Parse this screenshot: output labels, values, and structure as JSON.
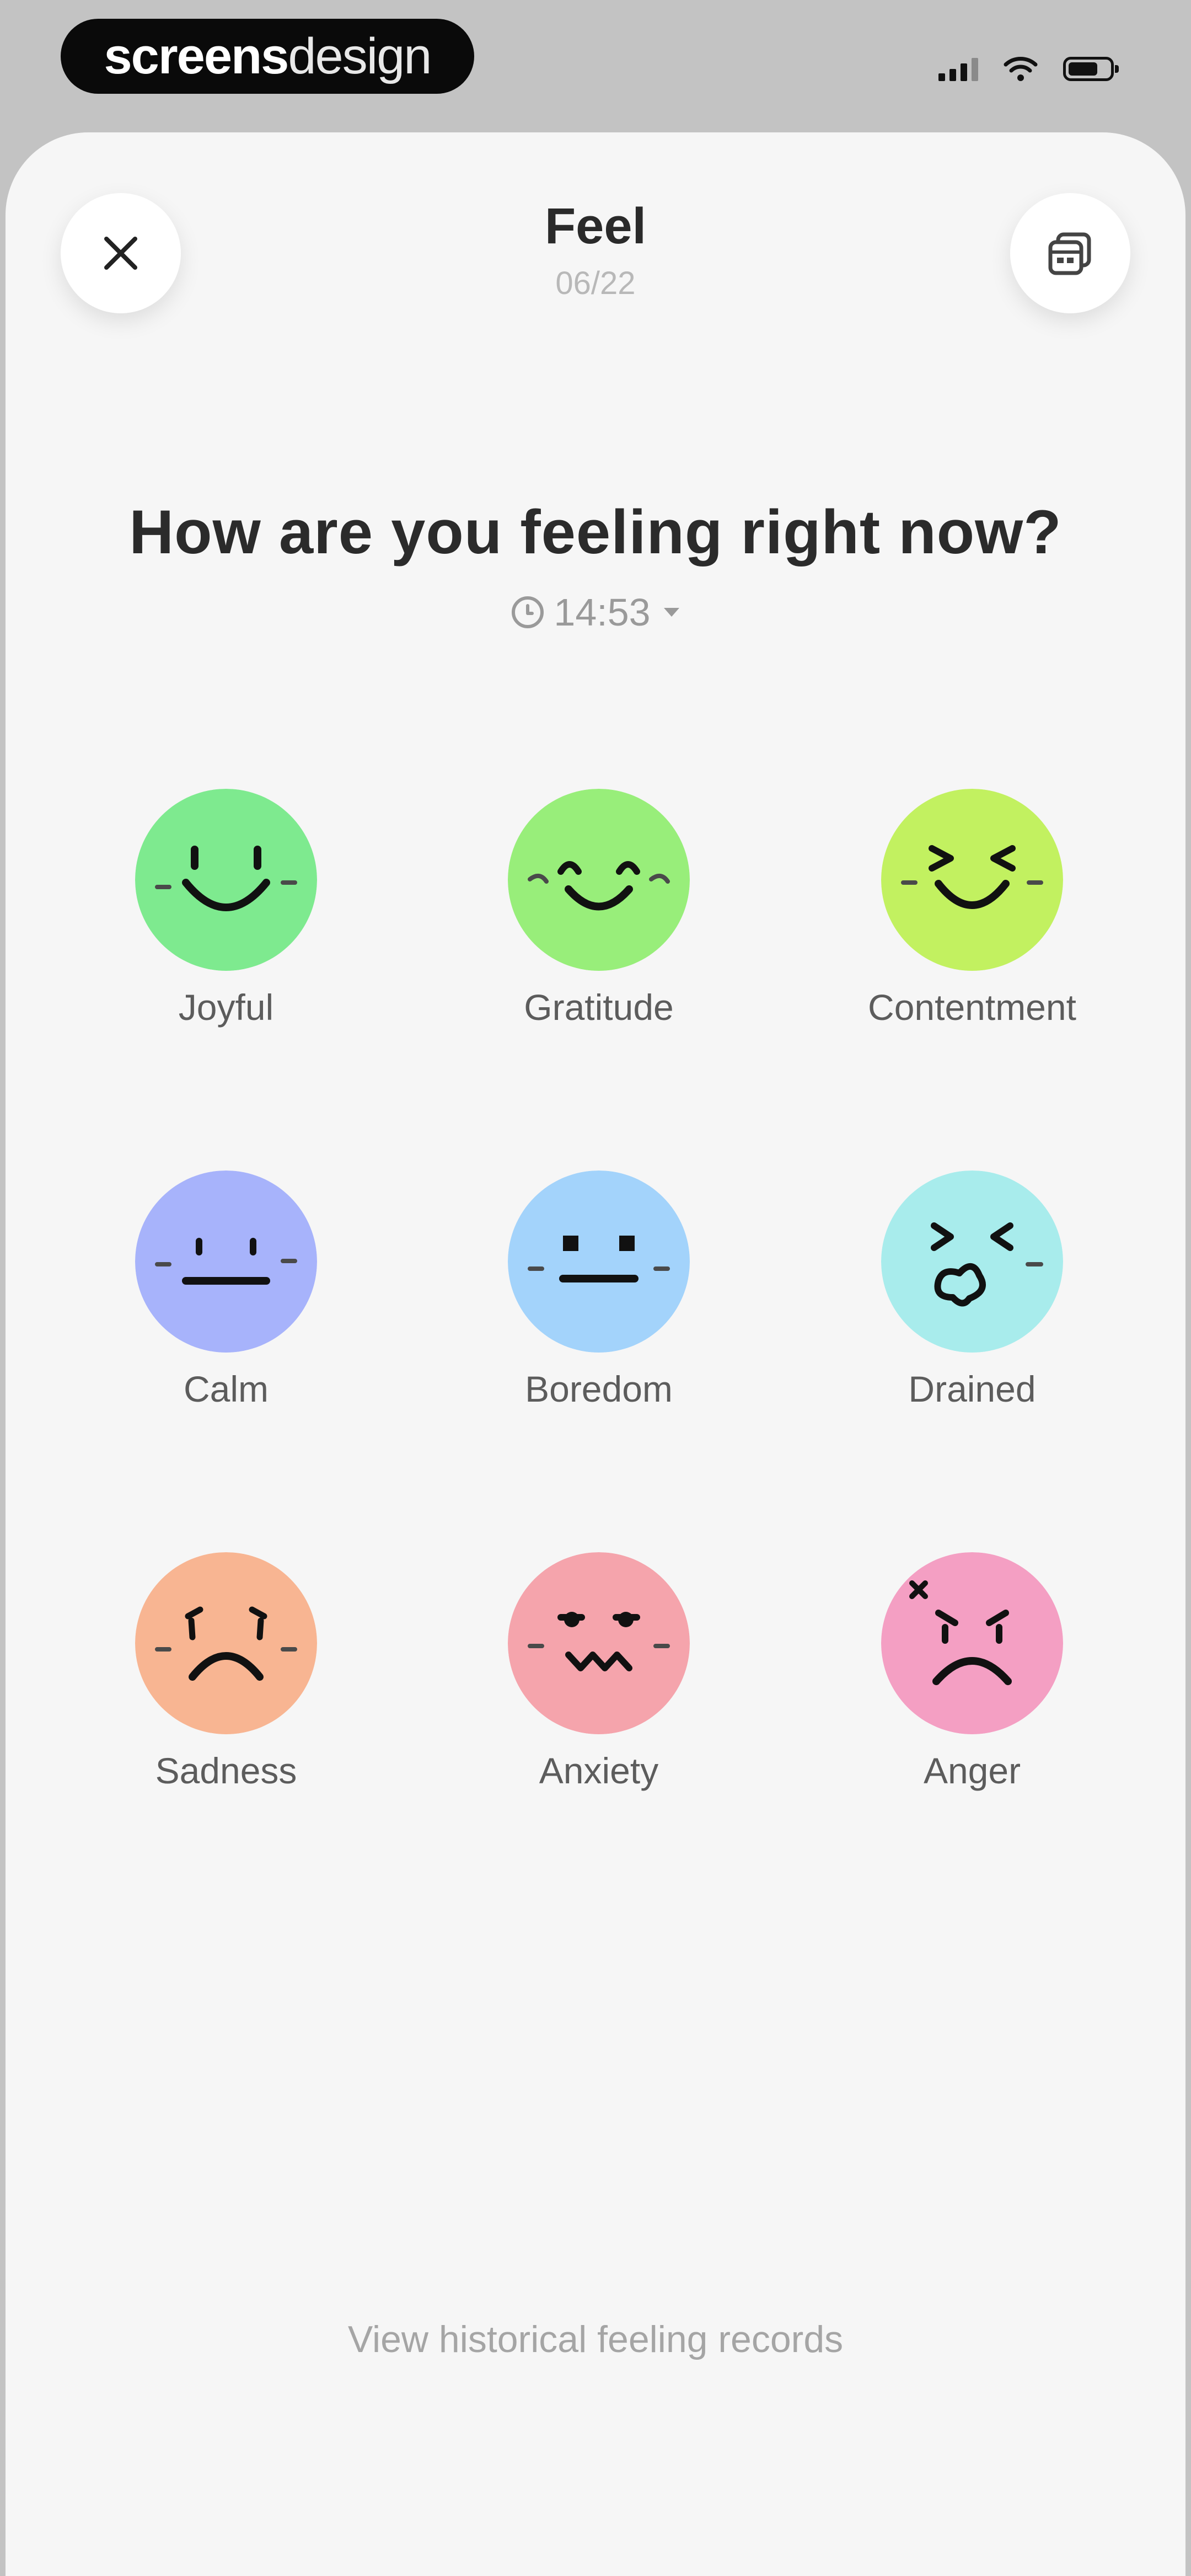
{
  "status_bar": {
    "brand_bold": "screens",
    "brand_light": "design"
  },
  "header": {
    "title": "Feel",
    "date": "06/22",
    "close_icon": "close-icon",
    "calendar_icon": "calendar-icon"
  },
  "main": {
    "question": "How are you feeling right now?",
    "time": "14:53"
  },
  "moods": [
    {
      "label": "Joyful",
      "color": "#7eea8f"
    },
    {
      "label": "Gratitude",
      "color": "#98ee7a"
    },
    {
      "label": "Contentment",
      "color": "#c2f160"
    },
    {
      "label": "Calm",
      "color": "#a7b3fb"
    },
    {
      "label": "Boredom",
      "color": "#a3d3fb"
    },
    {
      "label": "Drained",
      "color": "#a8ecec"
    },
    {
      "label": "Sadness",
      "color": "#f8b592"
    },
    {
      "label": "Anxiety",
      "color": "#f5a4ac"
    },
    {
      "label": "Anger",
      "color": "#f49fc3"
    }
  ],
  "footer": {
    "history_link": "View historical feeling records"
  }
}
